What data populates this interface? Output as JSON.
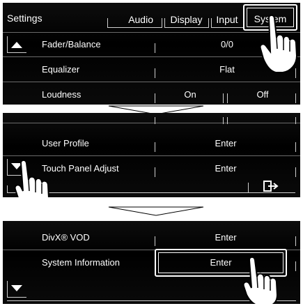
{
  "screen1": {
    "title": "Settings",
    "tabs": [
      "Audio",
      "Display",
      "Input",
      "System"
    ],
    "selected_tab": "System",
    "rows": [
      {
        "label": "Fader/Balance",
        "value": "0/0"
      },
      {
        "label": "Equalizer",
        "value": "Flat"
      },
      {
        "label": "Loudness",
        "on": "On",
        "off": "Off"
      }
    ],
    "scroll_icon": "up-arrow-icon"
  },
  "screen2": {
    "rows": [
      {
        "label": "User Profile",
        "value": "Enter"
      },
      {
        "label": "Touch Panel Adjust",
        "value": "Enter"
      }
    ],
    "scroll_icon": "down-arrow-icon",
    "exit_icon": "exit-icon"
  },
  "screen3": {
    "rows": [
      {
        "label": "DivX® VOD",
        "value": "Enter"
      },
      {
        "label": "System Information",
        "value": "Enter"
      }
    ],
    "scroll_icon": "down-arrow-icon"
  },
  "colors": {
    "background": "#000000",
    "text": "#ffffff",
    "line": "#cfcfcf",
    "page": "#ffffff"
  }
}
